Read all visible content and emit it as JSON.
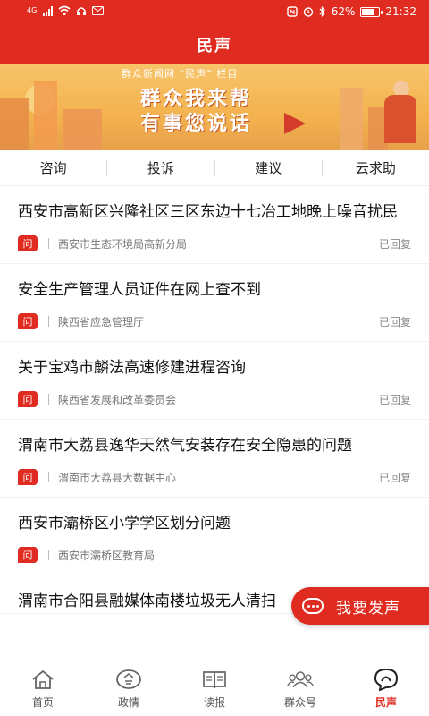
{
  "status_bar": {
    "network": "4G",
    "battery_percent": "62%",
    "time": "21:32"
  },
  "header": {
    "title": "民声"
  },
  "banner": {
    "subtitle": "群众新闻网 “民声” 栏目",
    "line1": "群众我来帮",
    "line2": "有事您说话"
  },
  "tabs": [
    {
      "label": "咨询"
    },
    {
      "label": "投诉"
    },
    {
      "label": "建议"
    },
    {
      "label": "云求助"
    }
  ],
  "items": [
    {
      "title": "西安市高新区兴隆社区三区东边十七冶工地晚上噪音扰民",
      "badge": "问",
      "department": "西安市生态环境局高新分局",
      "status": "已回复"
    },
    {
      "title": "安全生产管理人员证件在网上查不到",
      "badge": "问",
      "department": "陕西省应急管理厅",
      "status": "已回复"
    },
    {
      "title": "关于宝鸡市麟法高速修建进程咨询",
      "badge": "问",
      "department": "陕西省发展和改革委员会",
      "status": "已回复"
    },
    {
      "title": "渭南市大荔县逸华天然气安装存在安全隐患的问题",
      "badge": "问",
      "department": "渭南市大荔县大数据中心",
      "status": "已回复"
    },
    {
      "title": "西安市灞桥区小学学区划分问题",
      "badge": "问",
      "department": "西安市灞桥区教育局",
      "status": ""
    },
    {
      "title": "渭南市合阳县融媒体南楼垃圾无人清扫",
      "badge": "",
      "department": "",
      "status": ""
    }
  ],
  "fab": {
    "label": "我要发声",
    "icon": "chat-bubble-icon"
  },
  "bottom_nav": [
    {
      "label": "首页",
      "icon": "home-icon"
    },
    {
      "label": "政情",
      "icon": "politics-icon"
    },
    {
      "label": "读报",
      "icon": "newspaper-icon"
    },
    {
      "label": "群众号",
      "icon": "people-icon"
    },
    {
      "label": "民声",
      "icon": "voice-icon",
      "active": true
    }
  ],
  "colors": {
    "accent": "#e02b20"
  }
}
